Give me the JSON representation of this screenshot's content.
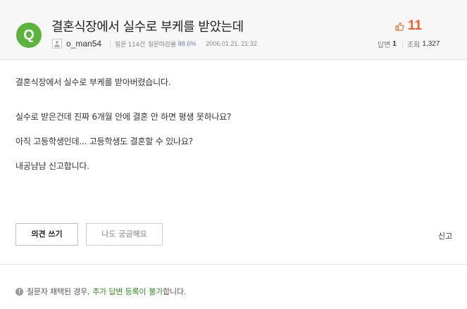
{
  "question": {
    "badge": "Q",
    "title": "결혼식장에서 실수로 부케를 받았는데",
    "author": "o_man54",
    "question_label": "질문 114건",
    "closing_label": "질문마감률",
    "closing_rate": "88.6%",
    "date": "2006.01.21. 21:32",
    "like_count": "11",
    "answer_label": "답변",
    "answer_count": "1",
    "view_label": "조회",
    "view_count": "1,327",
    "body": [
      "결혼식장에서 실수로 부케를 받아버렸습니다.",
      "실수로 받은건데 진짜 6개월 안에 결혼 안 하면 평생 못하나요?",
      "아직 고등학생인데... 고등학생도 결혼할 수 있나요?",
      "내공냠냠 신고합니다."
    ]
  },
  "actions": {
    "opinion_button": "의견 쓰기",
    "curious_button": "나도 궁금해요",
    "report_link": "신고"
  },
  "notice": {
    "prefix": "질문자 채택된 경우,",
    "highlight1": "추가 답변 등록이",
    "highlight2": "불가",
    "suffix": "합니다."
  },
  "colors": {
    "badge_green": "#5bb43b",
    "like_orange": "#f06223",
    "rate_blue": "#6e7dc0",
    "notice_green": "#2f8f1f"
  },
  "icons": [
    "q-badge-icon",
    "avatar-icon",
    "thumbs-up-icon",
    "info-icon"
  ]
}
